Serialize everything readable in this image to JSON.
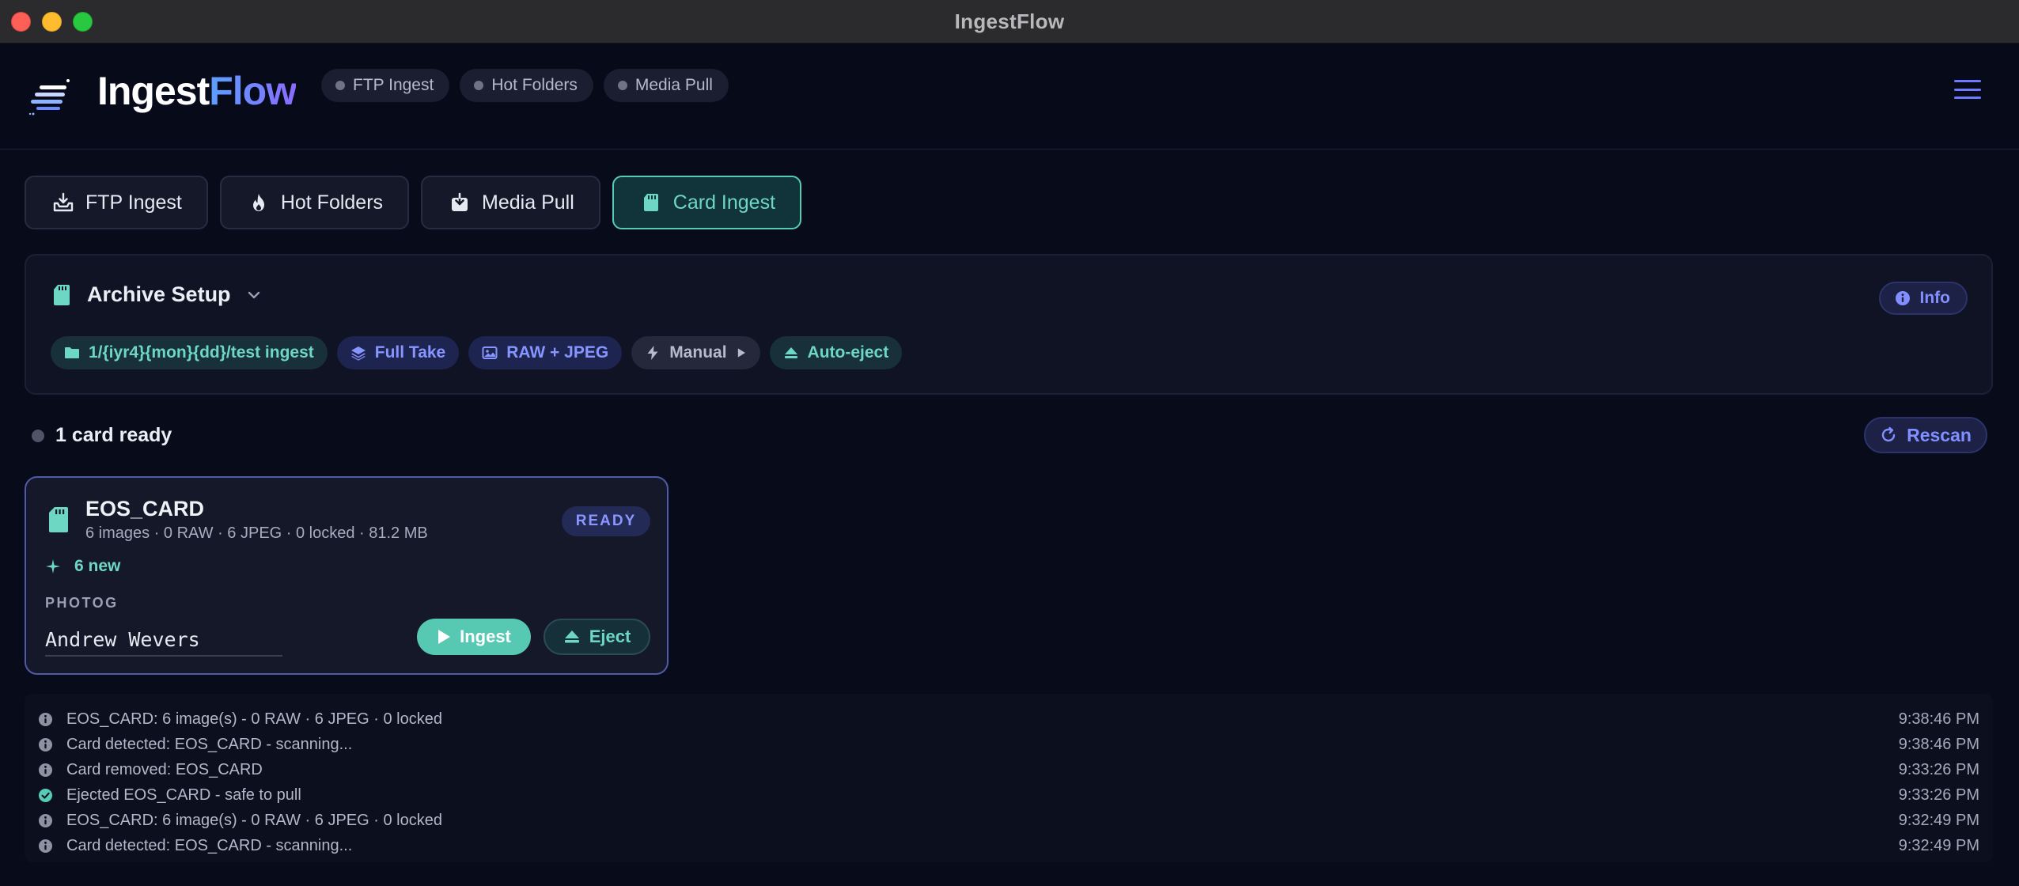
{
  "window": {
    "title": "IngestFlow"
  },
  "header": {
    "brand_part1": "Ingest",
    "brand_part2": "Flow",
    "status_pills": [
      "FTP Ingest",
      "Hot Folders",
      "Media Pull"
    ]
  },
  "tabs": [
    {
      "label": "FTP Ingest",
      "icon": "tray-download-icon",
      "active": false
    },
    {
      "label": "Hot Folders",
      "icon": "flame-icon",
      "active": false
    },
    {
      "label": "Media Pull",
      "icon": "download-box-icon",
      "active": false
    },
    {
      "label": "Card Ingest",
      "icon": "sd-card-icon",
      "active": true
    }
  ],
  "archive": {
    "title": "Archive Setup",
    "info_label": "Info",
    "chips": [
      {
        "label": "1/{iyr4}{mon}{dd}/test ingest",
        "icon": "folder-icon",
        "tone": "teal"
      },
      {
        "label": "Full Take",
        "icon": "layers-icon",
        "tone": "indigo"
      },
      {
        "label": "RAW + JPEG",
        "icon": "image-icon",
        "tone": "indigo"
      },
      {
        "label": "Manual",
        "icon": "bolt-icon",
        "tone": "gray"
      },
      {
        "label": "Auto-eject",
        "icon": "eject-icon",
        "tone": "teal"
      }
    ]
  },
  "cards": {
    "status": "1 card ready",
    "rescan_label": "Rescan",
    "items": [
      {
        "name": "EOS_CARD",
        "meta": "6 images · 0 RAW · 6 JPEG · 0 locked · 81.2 MB",
        "badge": "READY",
        "new_label": "6 new",
        "photog_label": "PHOTOG",
        "photog_value": "Andrew Wevers",
        "ingest_label": "Ingest",
        "eject_label": "Eject"
      }
    ]
  },
  "log": [
    {
      "icon": "info-icon",
      "message": "EOS_CARD: 6 image(s) - 0 RAW · 6 JPEG · 0 locked",
      "time": "9:38:46 PM"
    },
    {
      "icon": "info-icon",
      "message": "Card detected: EOS_CARD - scanning...",
      "time": "9:38:46 PM"
    },
    {
      "icon": "info-icon",
      "message": "Card removed: EOS_CARD",
      "time": "9:33:26 PM"
    },
    {
      "icon": "check-circle-icon",
      "message": "Ejected EOS_CARD - safe to pull",
      "time": "9:33:26 PM"
    },
    {
      "icon": "info-icon",
      "message": "EOS_CARD: 6 image(s) - 0 RAW · 6 JPEG · 0 locked",
      "time": "9:32:49 PM"
    },
    {
      "icon": "info-icon",
      "message": "Card detected: EOS_CARD - scanning...",
      "time": "9:32:49 PM"
    }
  ],
  "colors": {
    "background": "#080b1a",
    "accent_teal": "#56cbb6",
    "accent_indigo": "#6f79ff",
    "ready_badge": "#222a55"
  }
}
